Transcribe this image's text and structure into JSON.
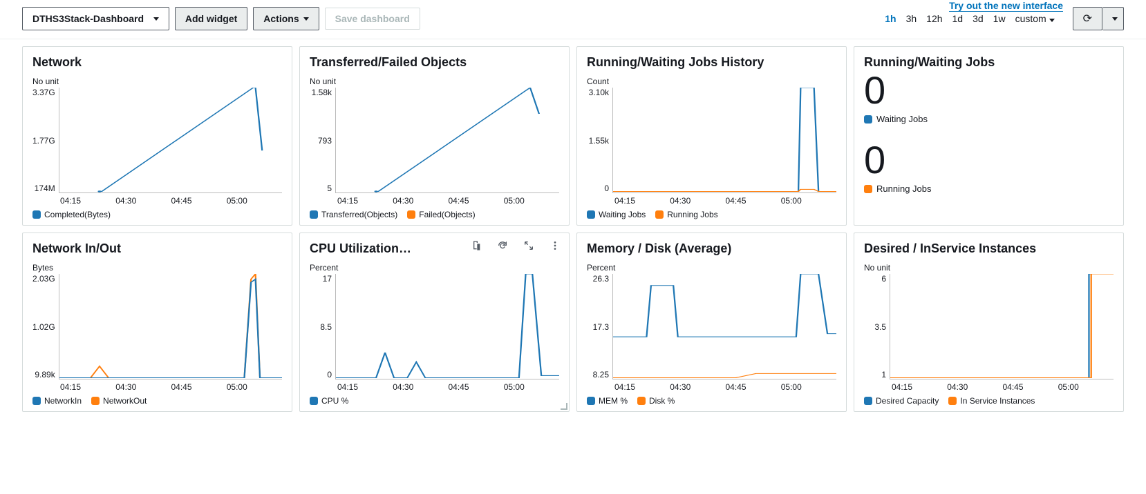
{
  "top_link_label": "Try out the new interface",
  "toolbar": {
    "dashboard_selector": "DTHS3Stack-Dashboard",
    "add_widget": "Add widget",
    "actions": "Actions",
    "save": "Save dashboard",
    "timerange": {
      "options": [
        "1h",
        "3h",
        "12h",
        "1d",
        "3d",
        "1w",
        "custom"
      ],
      "active": "1h"
    }
  },
  "colors": {
    "blue": "#1f77b4",
    "orange": "#ff7f0e"
  },
  "panels": {
    "network": {
      "title": "Network",
      "unit": "No unit",
      "y": [
        "3.37G",
        "1.77G",
        "174M"
      ],
      "x": [
        "04:15",
        "04:30",
        "04:45",
        "05:00"
      ],
      "legend": [
        {
          "label": "Completed(Bytes)",
          "color": "blue"
        }
      ]
    },
    "transferred": {
      "title": "Transferred/Failed Objects",
      "unit": "No unit",
      "y": [
        "1.58k",
        "793",
        "5"
      ],
      "x": [
        "04:15",
        "04:30",
        "04:45",
        "05:00"
      ],
      "legend": [
        {
          "label": "Transferred(Objects)",
          "color": "blue"
        },
        {
          "label": "Failed(Objects)",
          "color": "orange"
        }
      ]
    },
    "jobs_history": {
      "title": "Running/Waiting Jobs History",
      "unit": "Count",
      "y": [
        "3.10k",
        "1.55k",
        "0"
      ],
      "x": [
        "04:15",
        "04:30",
        "04:45",
        "05:00"
      ],
      "legend": [
        {
          "label": "Waiting Jobs",
          "color": "blue"
        },
        {
          "label": "Running Jobs",
          "color": "orange"
        }
      ]
    },
    "jobs_now": {
      "title": "Running/Waiting Jobs",
      "stats": [
        {
          "value": "0",
          "label": "Waiting Jobs",
          "color": "blue"
        },
        {
          "value": "0",
          "label": "Running Jobs",
          "color": "orange"
        }
      ]
    },
    "net_io": {
      "title": "Network In/Out",
      "unit": "Bytes",
      "y": [
        "2.03G",
        "1.02G",
        "9.89k"
      ],
      "x": [
        "04:15",
        "04:30",
        "04:45",
        "05:00"
      ],
      "legend": [
        {
          "label": "NetworkIn",
          "color": "blue"
        },
        {
          "label": "NetworkOut",
          "color": "orange"
        }
      ]
    },
    "cpu": {
      "title": "CPU Utilization (…",
      "unit": "Percent",
      "y": [
        "17",
        "8.5",
        "0"
      ],
      "x": [
        "04:15",
        "04:30",
        "04:45",
        "05:00"
      ],
      "legend": [
        {
          "label": "CPU %",
          "color": "blue"
        }
      ]
    },
    "mem": {
      "title": "Memory / Disk (Average)",
      "unit": "Percent",
      "y": [
        "26.3",
        "17.3",
        "8.25"
      ],
      "x": [
        "04:15",
        "04:30",
        "04:45",
        "05:00"
      ],
      "legend": [
        {
          "label": "MEM %",
          "color": "blue"
        },
        {
          "label": "Disk %",
          "color": "orange"
        }
      ]
    },
    "instances": {
      "title": "Desired / InService Instances",
      "unit": "No unit",
      "y": [
        "6",
        "3.5",
        "1"
      ],
      "x": [
        "04:15",
        "04:30",
        "04:45",
        "05:00"
      ],
      "legend": [
        {
          "label": "Desired Capacity",
          "color": "blue"
        },
        {
          "label": "In Service Instances",
          "color": "orange"
        }
      ]
    }
  },
  "chart_data": [
    {
      "id": "network",
      "type": "line",
      "xlabel": "",
      "ylabel": "No unit",
      "ylim": [
        174000000,
        3370000000
      ],
      "x": [
        "04:15",
        "04:20",
        "04:25",
        "04:30",
        "04:35",
        "04:40",
        "04:45",
        "04:50",
        "04:55",
        "05:00",
        "05:05",
        "05:10"
      ],
      "series": [
        {
          "name": "Completed(Bytes)",
          "color": "#1f77b4",
          "values": [
            null,
            null,
            174000000,
            null,
            null,
            null,
            null,
            null,
            null,
            null,
            3370000000,
            1300000000
          ]
        }
      ]
    },
    {
      "id": "transferred",
      "type": "line",
      "xlabel": "",
      "ylabel": "No unit",
      "ylim": [
        5,
        1580
      ],
      "x": [
        "04:15",
        "04:20",
        "04:25",
        "04:30",
        "04:35",
        "04:40",
        "04:45",
        "04:50",
        "04:55",
        "05:00",
        "05:05",
        "05:10"
      ],
      "series": [
        {
          "name": "Transferred(Objects)",
          "color": "#1f77b4",
          "values": [
            null,
            null,
            5,
            null,
            null,
            null,
            null,
            null,
            null,
            null,
            1580,
            1200
          ]
        },
        {
          "name": "Failed(Objects)",
          "color": "#ff7f0e",
          "values": [
            null,
            null,
            null,
            null,
            null,
            null,
            null,
            null,
            null,
            null,
            null,
            null
          ]
        }
      ]
    },
    {
      "id": "jobs_history",
      "type": "line",
      "xlabel": "",
      "ylabel": "Count",
      "ylim": [
        0,
        3100
      ],
      "x": [
        "04:15",
        "04:20",
        "04:25",
        "04:30",
        "04:35",
        "04:40",
        "04:45",
        "04:50",
        "04:55",
        "05:00",
        "05:05",
        "05:08",
        "05:10",
        "05:12"
      ],
      "series": [
        {
          "name": "Waiting Jobs",
          "color": "#1f77b4",
          "values": [
            0,
            0,
            0,
            0,
            0,
            0,
            0,
            0,
            0,
            0,
            0,
            3100,
            3100,
            0
          ]
        },
        {
          "name": "Running Jobs",
          "color": "#ff7f0e",
          "values": [
            0,
            0,
            0,
            0,
            0,
            0,
            0,
            0,
            0,
            0,
            0,
            60,
            60,
            0
          ]
        }
      ]
    },
    {
      "id": "net_io",
      "type": "line",
      "xlabel": "",
      "ylabel": "Bytes",
      "ylim": [
        9890,
        2030000000
      ],
      "x": [
        "04:15",
        "04:20",
        "04:25",
        "04:30",
        "04:35",
        "04:40",
        "04:45",
        "04:50",
        "04:55",
        "05:00",
        "05:05",
        "05:08",
        "05:10",
        "05:12"
      ],
      "series": [
        {
          "name": "NetworkIn",
          "color": "#1f77b4",
          "values": [
            9890,
            9890,
            9890,
            9890,
            9890,
            9890,
            9890,
            9890,
            9890,
            9890,
            9890,
            1900000000,
            9890,
            9890
          ]
        },
        {
          "name": "NetworkOut",
          "color": "#ff7f0e",
          "values": [
            9890,
            9890,
            120000000,
            9890,
            9890,
            9890,
            9890,
            9890,
            9890,
            9890,
            9890,
            2030000000,
            9890,
            9890
          ]
        }
      ]
    },
    {
      "id": "cpu",
      "type": "line",
      "xlabel": "",
      "ylabel": "Percent",
      "ylim": [
        0,
        17
      ],
      "x": [
        "04:15",
        "04:20",
        "04:25",
        "04:30",
        "04:35",
        "04:40",
        "04:45",
        "04:50",
        "04:55",
        "05:00",
        "05:05",
        "05:08",
        "05:10",
        "05:12"
      ],
      "series": [
        {
          "name": "CPU %",
          "color": "#1f77b4",
          "values": [
            0,
            0,
            0,
            4,
            0,
            2.5,
            0,
            0,
            0,
            0,
            0,
            17,
            17,
            0.5
          ]
        }
      ]
    },
    {
      "id": "mem",
      "type": "line",
      "xlabel": "",
      "ylabel": "Percent",
      "ylim": [
        8.25,
        26.3
      ],
      "x": [
        "04:15",
        "04:20",
        "04:25",
        "04:30",
        "04:35",
        "04:40",
        "04:45",
        "04:50",
        "04:55",
        "05:00",
        "05:05",
        "05:08",
        "05:10",
        "05:12"
      ],
      "series": [
        {
          "name": "MEM %",
          "color": "#1f77b4",
          "values": [
            15.5,
            15.5,
            24.5,
            24.5,
            15.5,
            15.5,
            15.5,
            15.5,
            15.5,
            15.5,
            15.5,
            26.3,
            26.3,
            16
          ]
        },
        {
          "name": "Disk %",
          "color": "#ff7f0e",
          "values": [
            8.25,
            8.25,
            8.25,
            8.25,
            8.25,
            8.25,
            8.25,
            8.7,
            9,
            9,
            9,
            9,
            9,
            9
          ]
        }
      ]
    },
    {
      "id": "instances",
      "type": "line",
      "xlabel": "",
      "ylabel": "No unit",
      "ylim": [
        1,
        6
      ],
      "x": [
        "04:15",
        "04:20",
        "04:25",
        "04:30",
        "04:35",
        "04:40",
        "04:45",
        "04:50",
        "04:55",
        "05:00",
        "05:05",
        "05:08",
        "05:10",
        "05:12"
      ],
      "series": [
        {
          "name": "Desired Capacity",
          "color": "#1f77b4",
          "values": [
            1,
            1,
            1,
            1,
            1,
            1,
            1,
            1,
            1,
            1,
            1,
            1,
            6,
            6
          ]
        },
        {
          "name": "In Service Instances",
          "color": "#ff7f0e",
          "values": [
            1,
            1,
            1,
            1,
            1,
            1,
            1,
            1,
            1,
            1,
            1,
            1,
            6,
            6
          ]
        }
      ]
    }
  ]
}
